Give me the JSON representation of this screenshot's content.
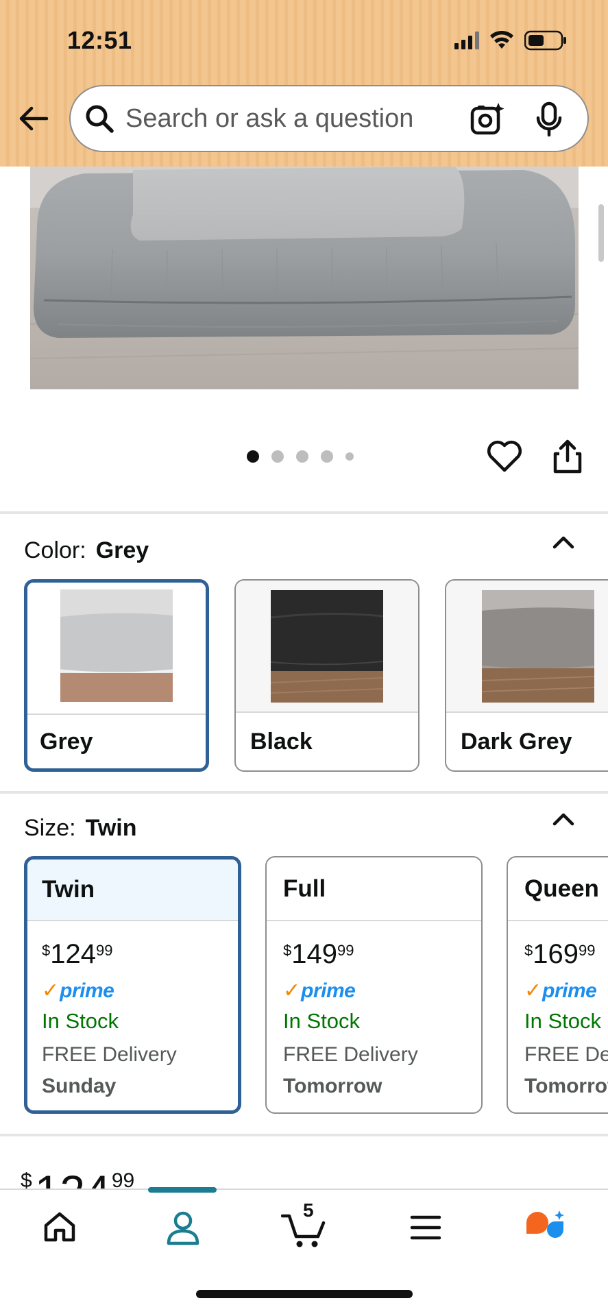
{
  "status_bar": {
    "time": "12:51"
  },
  "search": {
    "placeholder": "Search or ask a question"
  },
  "carousel": {
    "total_images": 5,
    "current_index": 1
  },
  "color_selector": {
    "label": "Color:",
    "selected": "Grey",
    "options": [
      {
        "name": "Grey",
        "swatch_color": "#c8c9ca"
      },
      {
        "name": "Black",
        "swatch_color": "#2a2a2a"
      },
      {
        "name": "Dark Grey",
        "swatch_color": "#9a9796"
      }
    ]
  },
  "size_selector": {
    "label": "Size:",
    "selected": "Twin",
    "options": [
      {
        "name": "Twin",
        "currency": "$",
        "price_whole": "124",
        "price_fraction": "99",
        "prime": "prime",
        "stock": "In Stock",
        "delivery": "FREE Delivery",
        "delivery_day": "Sunday"
      },
      {
        "name": "Full",
        "currency": "$",
        "price_whole": "149",
        "price_fraction": "99",
        "prime": "prime",
        "stock": "In Stock",
        "delivery": "FREE Delivery",
        "delivery_day": "Tomorrow"
      },
      {
        "name": "Queen",
        "currency": "$",
        "price_whole": "169",
        "price_fraction": "99",
        "prime": "prime",
        "stock": "In Stock",
        "delivery": "FREE Delivery",
        "delivery_day": "Tomorrow"
      }
    ]
  },
  "main_price": {
    "currency": "$",
    "whole": "124",
    "fraction": "99"
  },
  "bottom_nav": {
    "cart_count": "5",
    "items": [
      "home-icon",
      "account-icon",
      "cart-icon",
      "menu-icon",
      "rufus-assistant-icon"
    ]
  },
  "colors": {
    "header_bg": "#f1c38b",
    "selected_border": "#2f6195",
    "in_stock": "#007600",
    "prime_blue": "#1b8eee",
    "prime_check": "#f08804",
    "nav_active": "#1b7d8f",
    "assistant_orange": "#f4661f",
    "assistant_blue": "#1b8eee"
  }
}
